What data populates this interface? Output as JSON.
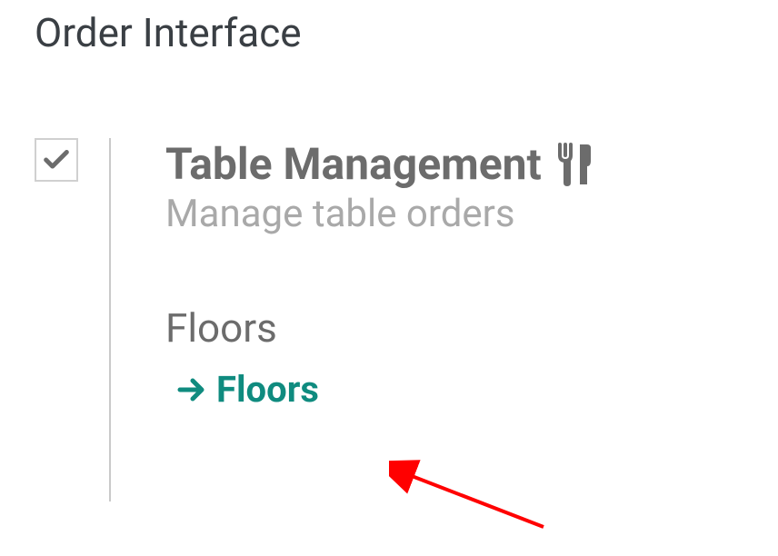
{
  "section": {
    "title": "Order Interface"
  },
  "setting": {
    "checked": true,
    "title": "Table Management",
    "subtitle": "Manage table orders"
  },
  "subsection": {
    "title": "Floors",
    "link_label": "Floors"
  },
  "colors": {
    "accent": "#0f8b7f"
  }
}
